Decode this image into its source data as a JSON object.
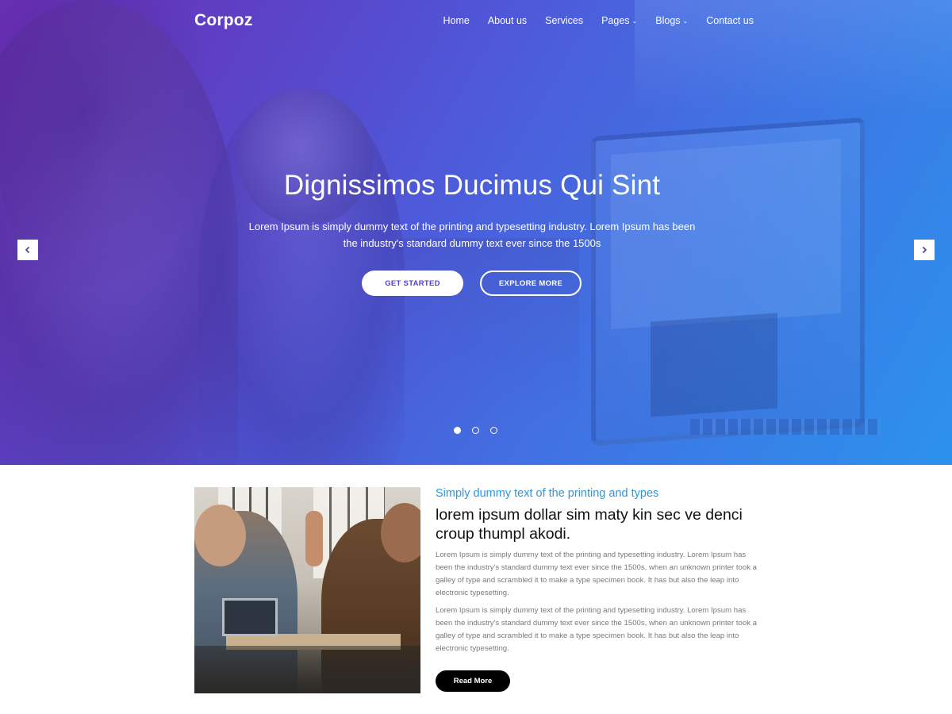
{
  "brand": {
    "logo": "Corpoz"
  },
  "nav": {
    "items": [
      {
        "label": "Home",
        "dropdown": false
      },
      {
        "label": "About us",
        "dropdown": false
      },
      {
        "label": "Services",
        "dropdown": false
      },
      {
        "label": "Pages",
        "dropdown": true
      },
      {
        "label": "Blogs",
        "dropdown": true
      },
      {
        "label": "Contact us",
        "dropdown": false
      }
    ]
  },
  "hero": {
    "title": "Dignissimos Ducimus Qui Sint",
    "text": "Lorem Ipsum is simply dummy text of the printing and typesetting industry. Lorem Ipsum has been the industry's standard dummy text ever since the 1500s",
    "primary_button": "GET STARTED",
    "secondary_button": "EXPLORE MORE",
    "slides": 3,
    "active_slide": 1,
    "colors": {
      "gradient_start": "#6a2fb5",
      "gradient_end": "#2b95ee",
      "button_text": "#5b3ad0"
    }
  },
  "about": {
    "kicker": "Simply dummy text of the printing and types",
    "title": "lorem ipsum dollar sim maty kin sec ve denci croup thumpl akodi.",
    "paragraphs": [
      "Lorem Ipsum is simply dummy text of the printing and typesetting industry. Lorem Ipsum has been the industry's standard dummy text ever since the 1500s, when an unknown printer took a galley of type and scrambled it to make a type specimen book. It has but also the leap into electronic typesetting.",
      "Lorem Ipsum is simply dummy text of the printing and typesetting industry. Lorem Ipsum has been the industry's standard dummy text ever since the 1500s, when an unknown printer took a galley of type and scrambled it to make a type specimen book. It has but also the leap into electronic typesetting."
    ],
    "button": "Read More",
    "colors": {
      "kicker": "#2d96dc",
      "button_bg": "#000000"
    }
  },
  "icons": {
    "prev": "chevron-left-icon",
    "next": "chevron-right-icon",
    "dropdown": "chevron-down-icon"
  }
}
